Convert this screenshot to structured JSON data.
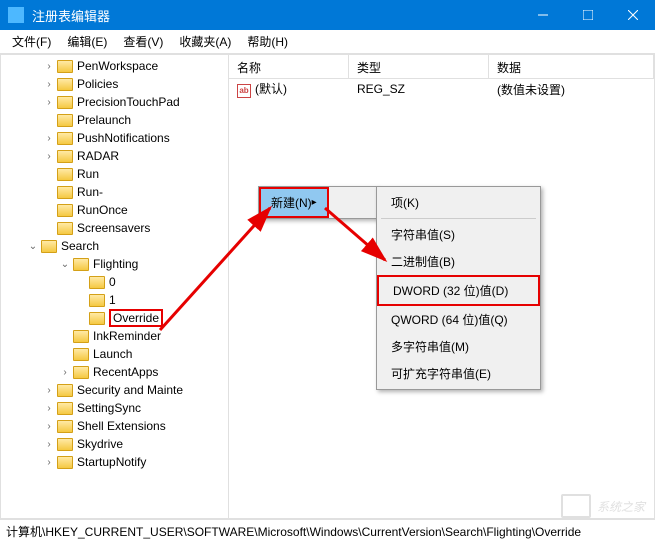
{
  "titlebar": {
    "title": "注册表编辑器"
  },
  "menubar": {
    "file": "文件(F)",
    "edit": "编辑(E)",
    "view": "查看(V)",
    "favorites": "收藏夹(A)",
    "help": "帮助(H)"
  },
  "tree": {
    "items": [
      "PenWorkspace",
      "Policies",
      "PrecisionTouchPad",
      "Prelaunch",
      "PushNotifications",
      "RADAR",
      "Run",
      "Run-",
      "RunOnce",
      "Screensavers",
      "Search",
      "Flighting",
      "0",
      "1",
      "Override",
      "InkReminder",
      "Launch",
      "RecentApps",
      "Security and Mainte",
      "SettingSync",
      "Shell Extensions",
      "Skydrive",
      "StartupNotify"
    ]
  },
  "list": {
    "header": {
      "name": "名称",
      "type": "类型",
      "data": "数据"
    },
    "row": {
      "name": "(默认)",
      "type": "REG_SZ",
      "data": "(数值未设置)"
    }
  },
  "context1": {
    "new": "新建(N)"
  },
  "context2": {
    "key": "项(K)",
    "string": "字符串值(S)",
    "binary": "二进制值(B)",
    "dword": "DWORD (32 位)值(D)",
    "qword": "QWORD (64 位)值(Q)",
    "multistring": "多字符串值(M)",
    "expandstring": "可扩充字符串值(E)"
  },
  "statusbar": {
    "path": "计算机\\HKEY_CURRENT_USER\\SOFTWARE\\Microsoft\\Windows\\CurrentVersion\\Search\\Flighting\\Override"
  },
  "watermark": {
    "text": "系统之家"
  }
}
